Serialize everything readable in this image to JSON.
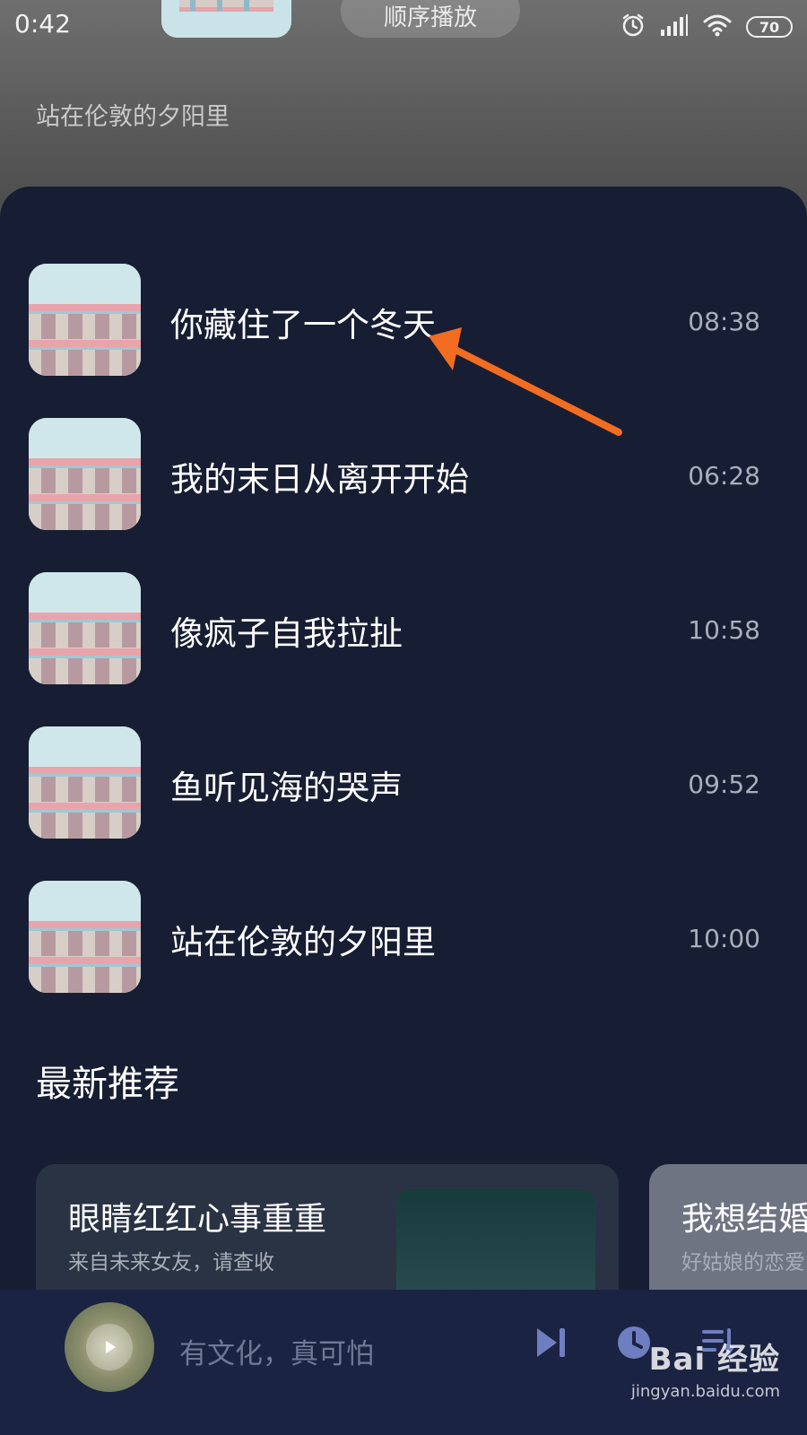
{
  "status_bar": {
    "time": "0:42",
    "battery": "70"
  },
  "top": {
    "mode_label": "顺序播放",
    "subtitle": "站在伦敦的夕阳里"
  },
  "songs": [
    {
      "title": "你藏住了一个冬天",
      "duration": "08:38"
    },
    {
      "title": "我的末日从离开开始",
      "duration": "06:28"
    },
    {
      "title": "像疯子自我拉扯",
      "duration": "10:58"
    },
    {
      "title": "鱼听见海的哭声",
      "duration": "09:52"
    },
    {
      "title": "站在伦敦的夕阳里",
      "duration": "10:00"
    }
  ],
  "recommend": {
    "section_title": "最新推荐",
    "cards": [
      {
        "title": "眼睛红红心事重重",
        "subtitle": "来自未来女友，请查收"
      },
      {
        "title": "我想结婚",
        "subtitle": "好姑娘的恋爱"
      }
    ]
  },
  "player": {
    "now_playing": "有文化，真可怕"
  },
  "watermark": {
    "logo": "Bai 经验",
    "url": "jingyan.baidu.com"
  },
  "colors": {
    "panel_bg": "#171e33",
    "player_bg": "#1b2342",
    "player_icon": "#6f7ec0",
    "annotation_arrow": "#f26d22"
  },
  "icons": {
    "status": [
      "alarm-icon",
      "signal-icon",
      "wifi-icon",
      "battery-icon"
    ],
    "player": [
      "play-icon",
      "next-icon",
      "timer-icon",
      "playlist-icon"
    ]
  }
}
